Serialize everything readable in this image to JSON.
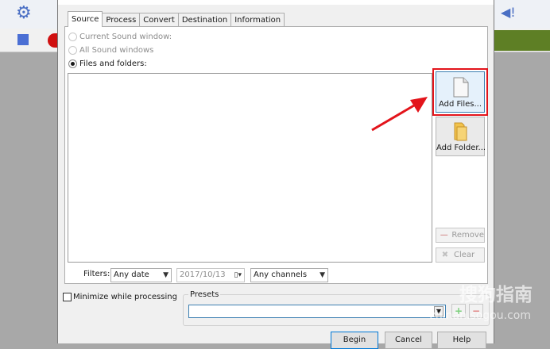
{
  "tabs": [
    {
      "label": "Source"
    },
    {
      "label": "Process"
    },
    {
      "label": "Convert"
    },
    {
      "label": "Destination"
    },
    {
      "label": "Information"
    }
  ],
  "source": {
    "radio_current": "Current Sound window:",
    "radio_all": "All Sound windows",
    "radio_files": "Files and folders:",
    "add_files": "Add Files...",
    "add_folder": "Add Folder...",
    "remove": "Remove",
    "clear": "Clear"
  },
  "filters": {
    "label": "Filters:",
    "date_filter": "Any date",
    "date_value": "2017/10/13",
    "channels": "Any channels"
  },
  "options": {
    "minimize": "Minimize while processing",
    "presets_label": "Presets"
  },
  "buttons": {
    "begin": "Begin",
    "cancel": "Cancel",
    "help": "Help"
  },
  "watermark": {
    "text": "搜狗指南",
    "url": "zhinan.sogou.com"
  },
  "colors": {
    "annotation": "#e3141b",
    "accent": "#3c7fb1"
  }
}
